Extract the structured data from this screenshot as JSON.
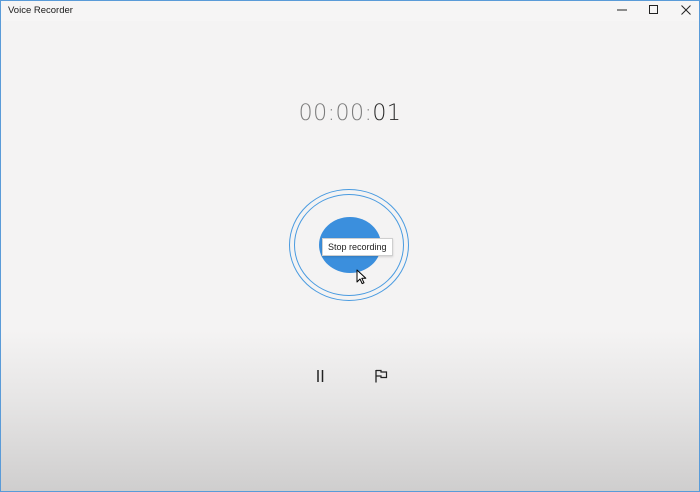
{
  "window": {
    "title": "Voice Recorder",
    "accent_color": "#3b8fdd",
    "border_color": "#5a9bd8"
  },
  "titlebar": {
    "controls": [
      {
        "name": "minimize",
        "icon": "minimize-icon"
      },
      {
        "name": "maximize",
        "icon": "maximize-icon"
      },
      {
        "name": "close",
        "icon": "close-icon"
      }
    ]
  },
  "timer": {
    "hours": "00",
    "sep1": ":",
    "minutes": "00",
    "sep2": ":",
    "seconds": "01"
  },
  "record": {
    "tooltip": "Stop recording",
    "state_icon": "stop-recording-icon"
  },
  "controls": {
    "pause_icon": "pause-icon",
    "marker_icon": "flag-icon"
  }
}
